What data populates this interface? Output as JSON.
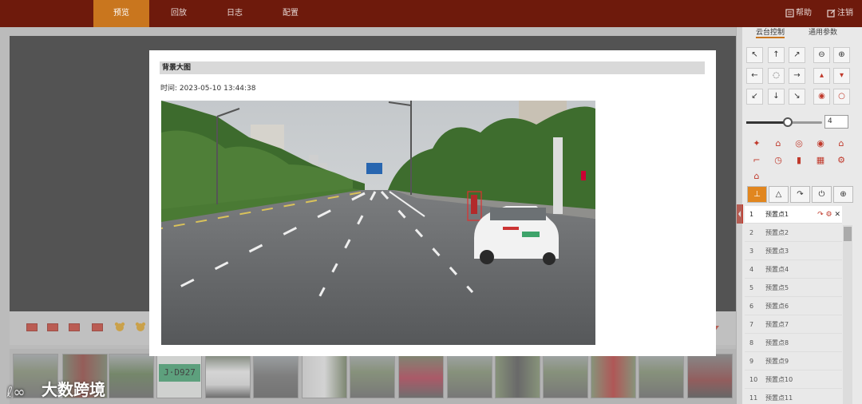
{
  "nav": {
    "tabs": [
      "预览",
      "回放",
      "日志",
      "配置"
    ],
    "active_index": 0,
    "help_label": "帮助",
    "logout_label": "注销"
  },
  "panel": {
    "tabs": [
      "云台控制",
      "通用参数"
    ],
    "speed_value": "4",
    "speed_level": 0.55,
    "presets": [
      {
        "num": "1",
        "name": "预置点1"
      },
      {
        "num": "2",
        "name": "预置点2"
      },
      {
        "num": "3",
        "name": "预置点3"
      },
      {
        "num": "4",
        "name": "预置点4"
      },
      {
        "num": "5",
        "name": "预置点5"
      },
      {
        "num": "6",
        "name": "预置点6"
      },
      {
        "num": "7",
        "name": "预置点7"
      },
      {
        "num": "8",
        "name": "预置点8"
      },
      {
        "num": "9",
        "name": "预置点9"
      },
      {
        "num": "10",
        "name": "预置点10"
      },
      {
        "num": "11",
        "name": "预置点11"
      }
    ]
  },
  "modal": {
    "title": "背景大图",
    "time_label": "时间:",
    "time_value": "2023-05-10 13:44:38",
    "plate_text": "J·D927"
  },
  "watermark": "大数跨境",
  "colors": {
    "topbar": "#6e1a0c",
    "accent": "#c9761e",
    "button_red": "#c8382a"
  }
}
